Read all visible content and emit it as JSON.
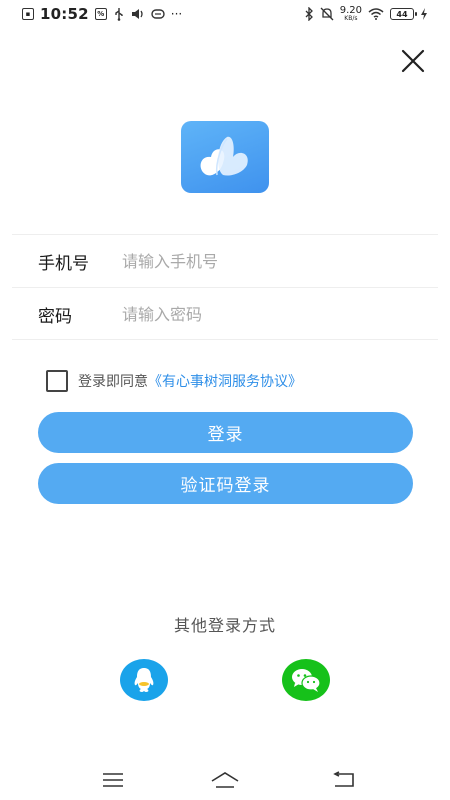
{
  "status_bar": {
    "time": "10:52",
    "net_speed": "9.20",
    "net_speed_unit": "KB/s",
    "battery": "44",
    "more": "···"
  },
  "form": {
    "phone_label": "手机号",
    "phone_placeholder": "请输入手机号",
    "password_label": "密码",
    "password_placeholder": "请输入密码"
  },
  "agreement": {
    "prefix": "登录即同意",
    "link": "《有心事树洞服务协议》",
    "checked": false
  },
  "buttons": {
    "login": "登录",
    "sms_login": "验证码登录"
  },
  "other_login": {
    "title": "其他登录方式",
    "providers": [
      "qq-icon",
      "wechat-icon"
    ]
  },
  "colors": {
    "accent": "#54aaf2",
    "link": "#2f8fe8",
    "qq": "#1aa3ea",
    "wechat": "#16c11a",
    "logo_top": "#5fb4f8",
    "logo_bottom": "#3f92ee"
  }
}
